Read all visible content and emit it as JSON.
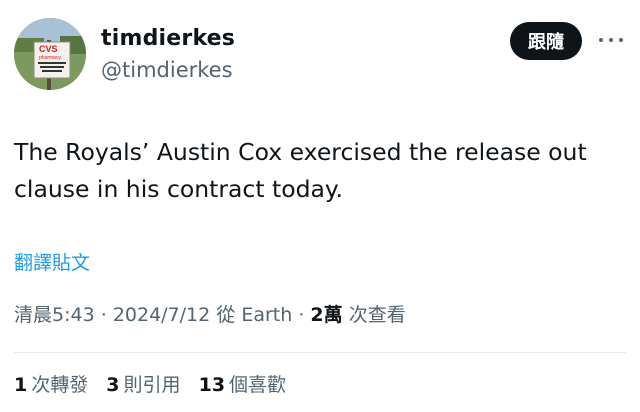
{
  "author": {
    "display_name": "timdierkes",
    "handle": "@timdierkes",
    "avatar": {
      "sign_brand": "CVS",
      "sign_subtitle": "pharmacy"
    }
  },
  "header": {
    "follow_label": "跟隨",
    "more_icon": "more-horizontal-icon"
  },
  "tweet": {
    "text": "The Royals’ Austin Cox exercised the release out clause in his contract today.",
    "translate_label": "翻譯貼文"
  },
  "meta": {
    "time": "清晨5:43",
    "separator": "·",
    "date": "2024/7/12",
    "source": "從 Earth",
    "views_count": "2萬",
    "views_label": "次查看"
  },
  "stats": {
    "reposts_count": "1",
    "reposts_label": "次轉發",
    "quotes_count": "3",
    "quotes_label": "則引用",
    "likes_count": "13",
    "likes_label": "個喜歡"
  },
  "colors": {
    "text": "#0f1419",
    "muted": "#536471",
    "link": "#1d9bf0",
    "button_bg": "#0f1419"
  }
}
